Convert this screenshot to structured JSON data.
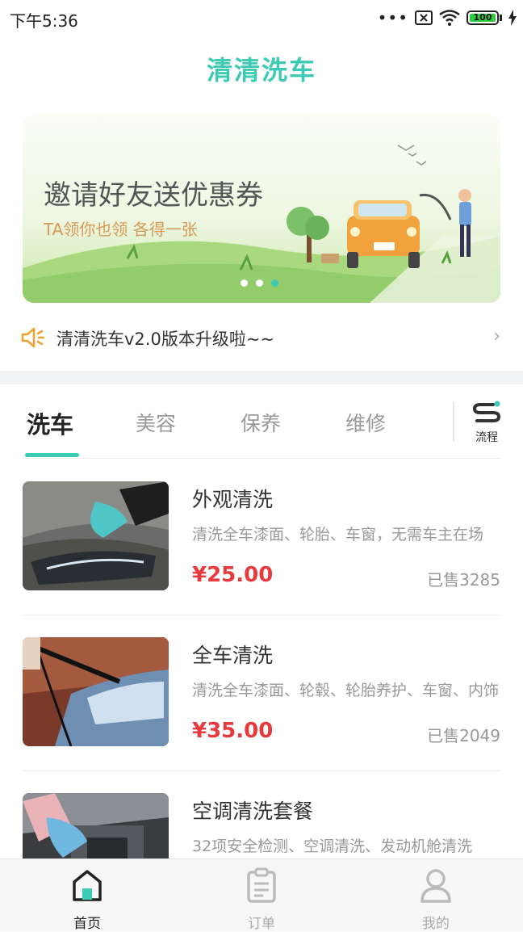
{
  "status_bar": {
    "time": "下午5:36",
    "dots": "•••",
    "battery": "100"
  },
  "header": {
    "title": "清清洗车"
  },
  "banner": {
    "title": "邀请好友送优惠券",
    "subtitle": "TA领你也领 各得一张"
  },
  "notice": {
    "text": "清清洗车v2.0版本升级啦~~",
    "chevron": "›"
  },
  "tabs": {
    "items": [
      {
        "label": "洗车"
      },
      {
        "label": "美容"
      },
      {
        "label": "保养"
      },
      {
        "label": "维修"
      }
    ],
    "process_label": "流程"
  },
  "services": [
    {
      "name": "外观清洗",
      "desc": "清洗全车漆面、轮胎、车窗，无需车主在场",
      "price": "¥25.00",
      "sold": "已售3285"
    },
    {
      "name": "全车清洗",
      "desc": "清洗全车漆面、轮毂、轮胎养护、车窗、内饰",
      "price": "¥35.00",
      "sold": "已售2049"
    },
    {
      "name": "空调清洗套餐",
      "desc": "32项安全检测、空调清洗、发动机舱清洗",
      "price": "",
      "sold": ""
    }
  ],
  "bottom_nav": [
    {
      "label": "首页"
    },
    {
      "label": "订单"
    },
    {
      "label": "我的"
    }
  ],
  "colors": {
    "accent": "#3ccab4",
    "price": "#e8393d",
    "notice_icon": "#f0a030"
  },
  "icons": {
    "signal": "signal-icon",
    "no-sim": "no-sim-icon",
    "wifi": "wifi-icon",
    "battery": "battery-icon",
    "charging": "charging-icon",
    "speaker": "speaker-icon",
    "chevron": "chevron-right-icon",
    "process": "process-icon",
    "home": "home-icon",
    "orders": "orders-icon",
    "profile": "profile-icon"
  }
}
